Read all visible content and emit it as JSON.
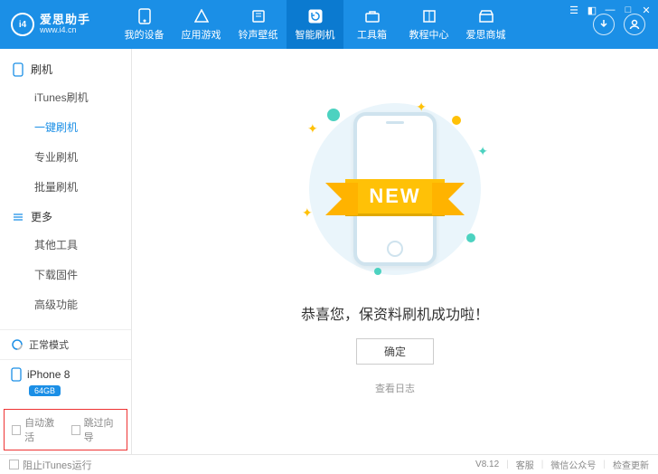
{
  "brand": {
    "name": "爱思助手",
    "url": "www.i4.cn",
    "logo_text": "i4"
  },
  "nav": {
    "items": [
      {
        "label": "我的设备",
        "icon": "phone"
      },
      {
        "label": "应用游戏",
        "icon": "apps"
      },
      {
        "label": "铃声壁纸",
        "icon": "music"
      },
      {
        "label": "智能刷机",
        "icon": "refresh",
        "active": true
      },
      {
        "label": "工具箱",
        "icon": "toolbox"
      },
      {
        "label": "教程中心",
        "icon": "book"
      },
      {
        "label": "爱思商城",
        "icon": "store"
      }
    ]
  },
  "sidebar": {
    "groups": [
      {
        "title": "刷机",
        "icon": "phone",
        "items": [
          {
            "label": "iTunes刷机"
          },
          {
            "label": "一键刷机",
            "active": true
          },
          {
            "label": "专业刷机"
          },
          {
            "label": "批量刷机"
          }
        ]
      },
      {
        "title": "更多",
        "icon": "menu",
        "items": [
          {
            "label": "其他工具"
          },
          {
            "label": "下载固件"
          },
          {
            "label": "高级功能"
          }
        ]
      }
    ],
    "status": {
      "label": "正常模式"
    },
    "device": {
      "name": "iPhone 8",
      "storage": "64GB"
    },
    "options": {
      "auto_activate": "自动激活",
      "skip_guide": "跳过向导"
    }
  },
  "main": {
    "ribbon": "NEW",
    "success": "恭喜您，保资料刷机成功啦！",
    "ok": "确定",
    "log": "查看日志"
  },
  "statusbar": {
    "block_itunes": "阻止iTunes运行",
    "version": "V8.12",
    "links": {
      "support": "客服",
      "wechat": "微信公众号",
      "update": "检查更新"
    }
  }
}
